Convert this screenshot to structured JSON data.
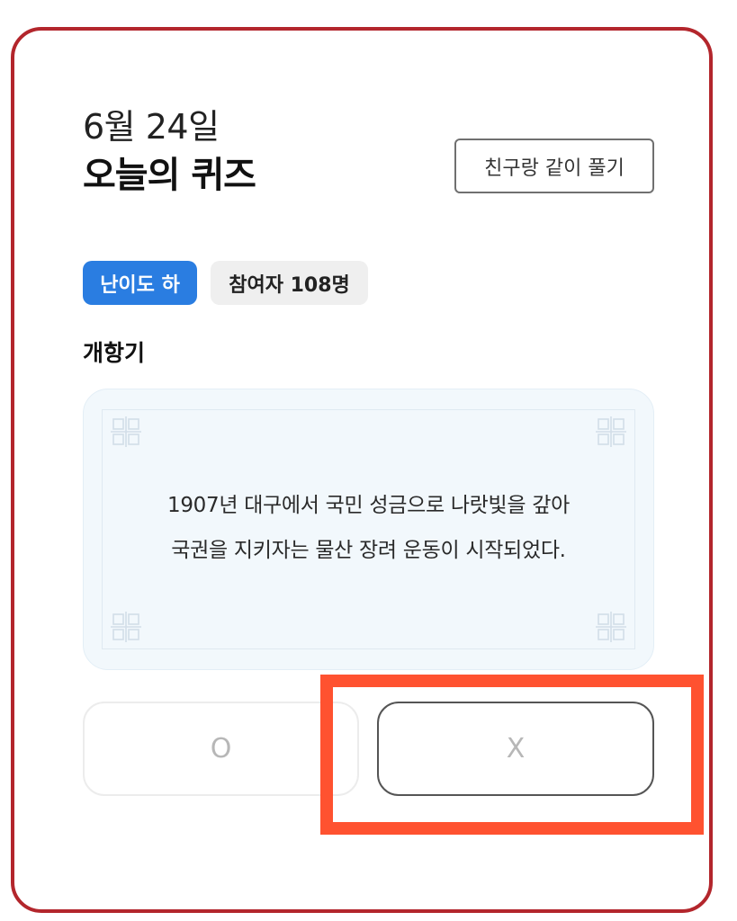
{
  "quiz": {
    "date": "6월 24일",
    "title": "오늘의 퀴즈",
    "friend_button_label": "친구랑 같이 풀기",
    "difficulty_badge": "난이도 하",
    "participants_badge": "참여자 108명",
    "topic": "개항기",
    "question_line1": "1907년 대구에서 국민 성금으로 나랏빛을 갚아",
    "question_line2": "국권을 지키자는 물산 장려 운동이 시작되었다.",
    "answer_o_label": "O",
    "answer_x_label": "X"
  },
  "colors": {
    "card_border": "#b3262c",
    "difficulty_badge_bg": "#2a7de1",
    "highlight": "#ff5230",
    "question_bg": "#f2f8fc"
  },
  "icons": {
    "corner_ornament": "traditional-knot-icon"
  }
}
